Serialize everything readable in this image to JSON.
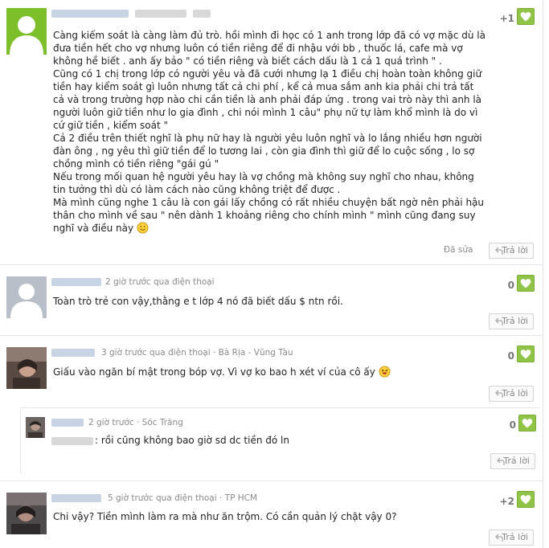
{
  "comments": [
    {
      "score": "+1",
      "edited": "Đã sửa",
      "reply": "Trả lời",
      "paragraphs": [
        "Càng kiếm soát là càng làm đủ trò. hồi mình đi học có 1 anh trong lớp đã có vợ mặc dù là đưa tiền hết cho vợ nhưng luôn có tiền riêng để đi nhậu với bb , thuốc lá, cafe mà vợ không hề biết . anh ấy bảo \" có tiền riêng và biết cách dấu là 1 cả 1 quá trình \" .",
        "Cũng có 1 chị trong lớp có người yêu và đã cưới nhưng lạ 1 điều chị hoàn toàn không giữ tiền hay kiểm soát gì luôn nhưng tất cả chi phí , kể cả mua sắm anh kia phải chi trả tất cả và trong trường hợp nào chi cần tiền là anh phải đáp ứng . trong vai trò này thì anh là người luôn giữ tiền như lo gia đình , chi nói mình 1 câu\" phụ nữ tự làm khổ mình là do vì cứ giữ tiền , kiểm soát \"",
        "Cả 2 điều trên thiết nghĩ là phụ nữ hay là người yêu luôn nghĩ và lo lắng nhiều hơn người đàn ông , ng yêu thì giữ tiền để lo tương lai , còn gia đình thì giữ để lo cuộc sống , lo sợ chồng mình có tiền riêng \"gái gú \"",
        "Nếu trong mối quan hệ người yêu hay là vợ chồng mà không suy nghĩ cho nhau, không tin tưởng thì dù có làm cách nào cũng không triệt để được .",
        "Mà mình cũng nghe 1 câu là con gái lấy chồng có rất nhiều chuyện bất ngờ nên phải hậu thân cho mình về sau \" nên dành 1 khoảng riêng cho chính mình \" mình cũng đang suy nghĩ và điều này"
      ]
    },
    {
      "meta": "2 giờ trước qua điện thoại",
      "text": "Toàn trò trẻ con vậy,thằng e t lớp 4 nó đã biết dấu $ ntn rồi.",
      "score": "0",
      "reply": "Trả lời"
    },
    {
      "meta": "3 giờ trước qua điện thoại · Bà Rịa - Vũng Tàu",
      "text": "Giấu vào ngăn bí mật trong bóp vợ. Vì vợ ko bao h xét ví của cô ấy",
      "score": "0",
      "reply": "Trả lời"
    },
    {
      "meta": "2 giờ trước · Sóc Trăng",
      "text": ": rồi cũng không bao giờ sd dc tiền đó ln",
      "score": "0",
      "reply": "Trả lời"
    },
    {
      "meta": "5 giờ trước qua điện thoại · TP HCM",
      "text": "Chi vậy? Tiền mình làm ra mà như ăn trộm. Có cần quản lý chặt vậy 0?",
      "score": "+2",
      "reply": "Trả lời"
    }
  ],
  "colors": {
    "like_green": "#8fc446",
    "name_blur": "#c8d4e4",
    "meta_gray": "#8a8a8a"
  },
  "icons": {
    "like": "heart-icon",
    "reply": "reply-arrow-icon",
    "emoji_smile": "smile-emoji-icon",
    "emoji_laugh": "laugh-emoji-icon"
  }
}
